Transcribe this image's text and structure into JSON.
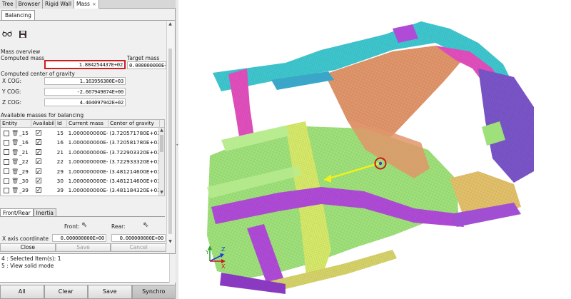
{
  "tabs": [
    {
      "label": "Tree"
    },
    {
      "label": "Browser"
    },
    {
      "label": "Rigid Wall"
    },
    {
      "label": "Mass",
      "close": "×"
    }
  ],
  "subtab": "Balancing",
  "mass_overview": {
    "title": "Mass overview",
    "computed_label": "Computed mass",
    "target_label": "Target mass",
    "computed_value": "1.884254437E+02",
    "target_value": "0.000000000E+"
  },
  "cog": {
    "title": "Computed center of gravity",
    "x_label": "X COG:",
    "y_label": "Y COG:",
    "z_label": "Z COG:",
    "x_value": "1.163956300E+03",
    "y_value": "-2.667949074E+00",
    "z_value": "4.404097942E+02"
  },
  "available": {
    "title": "Available masses for balancing",
    "headers": [
      "Entity",
      "Availability",
      "Id",
      "Current mass",
      "Center of gravity"
    ],
    "rows": [
      {
        "entity": "_15",
        "id": "15",
        "mass": "1.000000000E-03",
        "cog": "(3.720571780E+03, 5"
      },
      {
        "entity": "_16",
        "id": "16",
        "mass": "1.000000000E-03",
        "cog": "(3.720581780E+03, 5"
      },
      {
        "entity": "_21",
        "id": "21",
        "mass": "1.000000000E-03",
        "cog": "(3.722903320E+03, -"
      },
      {
        "entity": "_22",
        "id": "22",
        "mass": "1.000000000E-03",
        "cog": "(3.722933320E+03, -"
      },
      {
        "entity": "_29",
        "id": "29",
        "mass": "1.000000000E-03",
        "cog": "(3.481214600E+03, -"
      },
      {
        "entity": "_30",
        "id": "30",
        "mass": "1.000000000E-03",
        "cog": "(3.481214600E+03, -"
      },
      {
        "entity": "_39",
        "id": "39",
        "mass": "1.000000000E-03",
        "cog": "(3.481184320E+03, -"
      }
    ]
  },
  "lower_tabs": [
    "Front/Rear",
    "Inertia"
  ],
  "front_rear": {
    "front_label": "Front:",
    "rear_label": "Rear:",
    "x_axis_label": "X axis coordinate",
    "x_axis_value_1": "0.000000000E+00",
    "x_axis_value_2": "0.000000000E+00"
  },
  "actions": [
    "Close",
    "Save",
    "Cancel"
  ],
  "console": [
    "4 : Selected Item(s): 1",
    "5 : View solid mode"
  ],
  "bottom_buttons": [
    "All",
    "Clear",
    "Save",
    "Synchro"
  ],
  "axis_labels": {
    "x": "X",
    "y": "Y",
    "z": "Z"
  },
  "colors": {
    "selection_box": "#d11d1d",
    "floor_green": "#9ee07a",
    "tunnel_yellow": "#d7ea6a",
    "rail_purple": "#b04bd8",
    "frame_cyan": "#3fc7cf",
    "roof_salmon": "#e0956a",
    "pillar_pink": "#e24fbe",
    "vector_yellow": "#f2f21a",
    "cog_marker": "#d01818"
  }
}
